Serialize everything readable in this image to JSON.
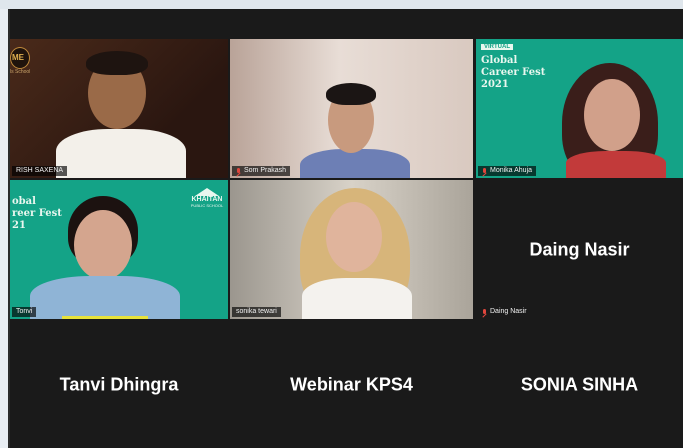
{
  "participants": [
    {
      "name": "RISH SAXENA",
      "video": true,
      "active": true
    },
    {
      "name": "Som Prakash",
      "video": true,
      "muted": true
    },
    {
      "name": "Monika Ahuja",
      "video": true,
      "muted": true
    },
    {
      "name": "Tonvi",
      "video": true
    },
    {
      "name": "sonika tewari",
      "video": true
    },
    {
      "name": "Daing Nasir",
      "display": "Daing Nasir",
      "video": false,
      "muted": true
    },
    {
      "name": "Tanvi Dhingra",
      "display": "Tanvi Dhingra",
      "video": false
    },
    {
      "name": "Webinar KPS4",
      "display": "Webinar KPS4",
      "video": false
    },
    {
      "name": "SONIA SINHA",
      "display": "SONIA SINHA",
      "video": false
    }
  ],
  "banners": {
    "monika": {
      "tag": "VIRTUAL",
      "line1": "Global",
      "line2": "Career Fest",
      "line3": "2021"
    },
    "tonvi": {
      "line1": "obal",
      "line2": "reer Fest",
      "line3": "21",
      "logo": "KHAITAN",
      "logo_sub": "PUBLIC SCHOOL"
    },
    "rish": {
      "logo": "ME",
      "logo_sub": "ls School"
    }
  },
  "colors": {
    "accent_active": "#c8e35a",
    "banner_green": "#14a387",
    "muted_red": "#e0463d"
  }
}
